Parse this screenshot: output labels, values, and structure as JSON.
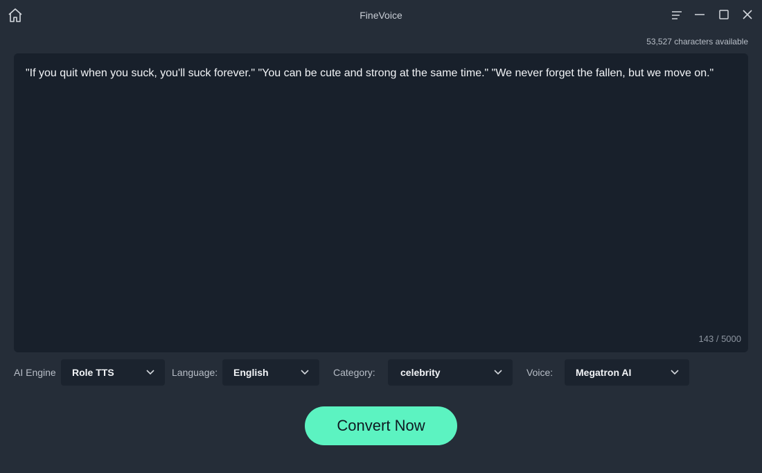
{
  "window": {
    "title": "FineVoice",
    "icons": {
      "home": "home-icon",
      "menu": "menu-icon",
      "minimize": "minimize-icon",
      "maximize": "maximize-icon",
      "close": "close-icon"
    }
  },
  "header": {
    "characters_available": "53,527 characters available"
  },
  "editor": {
    "text": "\"If you quit when you suck, you'll suck forever.\" \"You can be cute and strong at the same time.\" \"We never forget the fallen, but we move on.\"",
    "counter": "143 / 5000"
  },
  "options": {
    "ai_engine": {
      "label": "AI Engine",
      "value": "Role TTS"
    },
    "language": {
      "label": "Language:",
      "value": "English"
    },
    "category": {
      "label": "Category:",
      "value": "celebrity"
    },
    "voice": {
      "label": "Voice:",
      "value": "Megatron AI"
    }
  },
  "actions": {
    "convert_label": "Convert Now"
  },
  "colors": {
    "background": "#252d38",
    "editor_bg": "#18202b",
    "select_bg": "#1b232e",
    "accent": "#5cf3c1"
  }
}
